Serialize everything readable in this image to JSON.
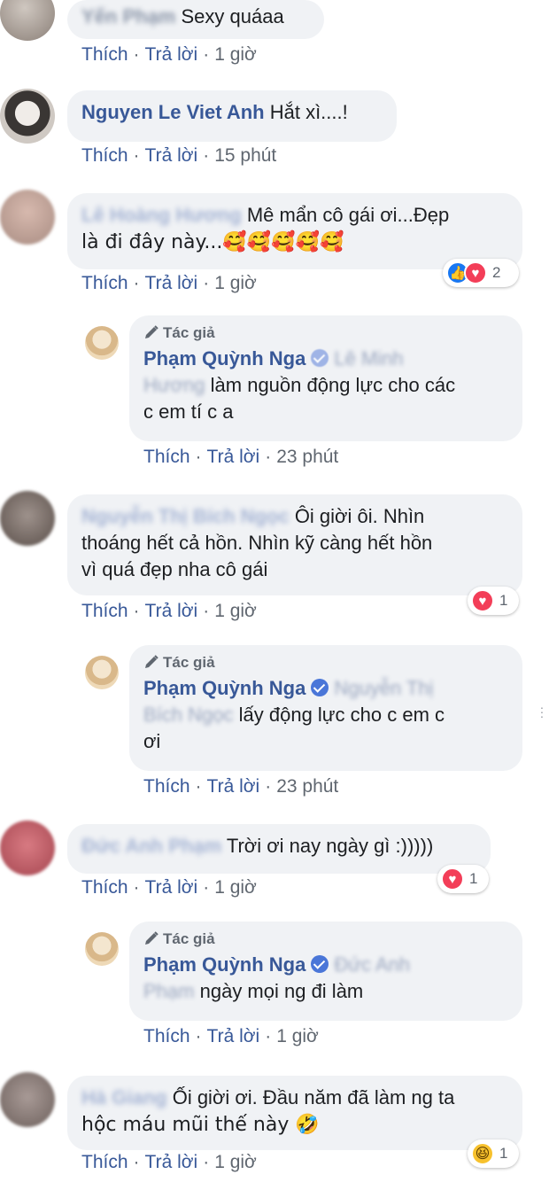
{
  "ui": {
    "like": "Thích",
    "reply": "Trả lời",
    "author_badge": "Tác giả"
  },
  "comments": [
    {
      "name": "Yến Phạm",
      "text": "Sexy quáaa",
      "time": "1 giờ"
    },
    {
      "name": "Nguyen Le Viet Anh",
      "text": "Hắt xì....!",
      "time": "15 phút"
    },
    {
      "name": "Lê Hoàng Hương",
      "text": "Mê mẩn cô gái ơi...Đẹp",
      "text2": "là đi đây này...🥰🥰🥰🥰🥰",
      "time": "1 giờ",
      "reaction_count": "2",
      "reply": {
        "name": "Phạm Quỳnh Nga",
        "tag1": "Lê Minh",
        "tag2": "Hương",
        "text1": "làm nguồn động lực cho các",
        "text2": "c em tí c a",
        "time": "23 phút"
      }
    },
    {
      "name": "Nguyễn Thị Bích Ngọc",
      "text": "Ôi giời ôi. Nhìn",
      "text2": "thoáng hết cả hồn. Nhìn kỹ càng hết hồn",
      "text3": "vì quá đẹp nha cô gái",
      "time": "1 giờ",
      "reaction_count": "1",
      "reply": {
        "name": "Phạm Quỳnh Nga",
        "tag1": "Nguyễn Thị",
        "tag2": "Bích Ngọc",
        "text1": "lấy động lực cho c em c",
        "text2": "ơi",
        "time": "23 phút"
      }
    },
    {
      "name": "Đức Anh Phạm",
      "text": "Trời ơi nay ngày gì :)))))",
      "time": "1 giờ",
      "reaction_count": "1",
      "reply": {
        "name": "Phạm Quỳnh Nga",
        "tag1": "Đức Anh",
        "tag2": "Phạm",
        "text1": "ngày mọi ng đi làm",
        "time": "1 giờ"
      }
    },
    {
      "name": "Hà Giang",
      "text": "Ối giời ơi. Đầu năm đã làm ng ta",
      "text2": "hộc máu mũi thế này 🤣",
      "time": "1 giờ",
      "reaction_count": "1"
    }
  ],
  "colors": {
    "link": "#385898",
    "bubble": "#f0f2f5",
    "like": "#1877f2",
    "love": "#f33e58",
    "haha": "#f7c12d"
  },
  "icons": {
    "author": "pencil-icon",
    "verified": "verified-badge-icon",
    "more": "more-options-icon"
  }
}
